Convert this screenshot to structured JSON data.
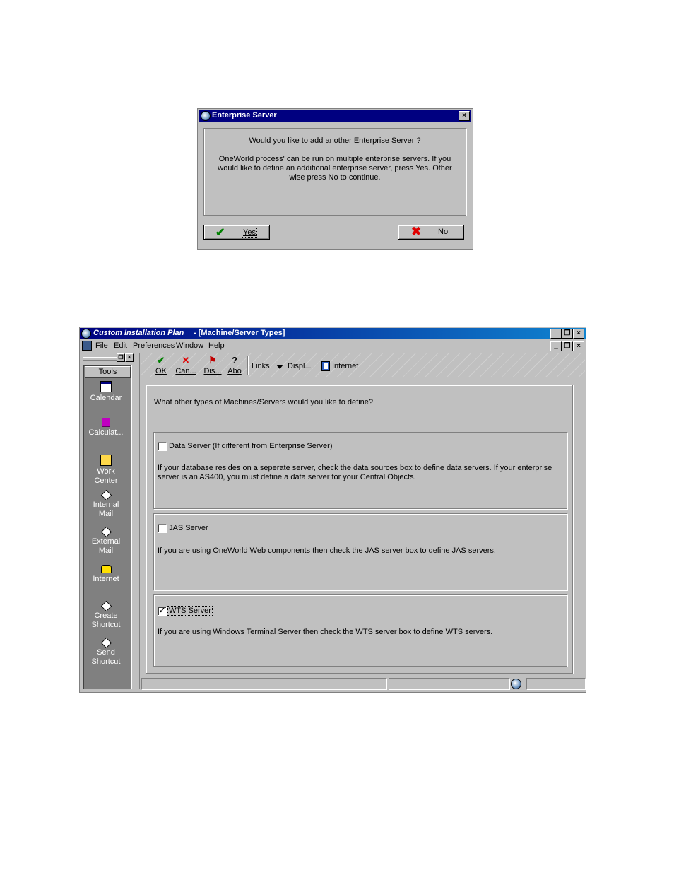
{
  "dialog": {
    "title": "Enterprise Server",
    "question": "Would you like to add another Enterprise Server ?",
    "body_line1": "OneWorld process' can be run on multiple enterprise servers.  If you",
    "body_line2": "would like to define an additional enterprise server, press Yes.  Other",
    "body_line3": "wise press No to continue.",
    "yes_label": "Yes",
    "no_label": "No",
    "close_label": "×"
  },
  "app": {
    "title_italic": "Custom Installation Plan",
    "title_rest": " - [Machine/Server Types]",
    "menu": [
      "File",
      "Edit",
      "Preferences",
      "Window",
      "Help"
    ],
    "toolbar": {
      "ok": "OK",
      "cancel": "Can...",
      "display": "Dis...",
      "about": "Abo",
      "links": "Links",
      "displ": "Displ...",
      "internet": "Internet"
    },
    "tools_header": "Tools",
    "tools": [
      {
        "line1": "Calendar",
        "line2": "",
        "icon": "calendar-icon"
      },
      {
        "line1": "Calculat...",
        "line2": "",
        "icon": "calculator-icon"
      },
      {
        "line1": "Work",
        "line2": "Center",
        "icon": "work-center-icon"
      },
      {
        "line1": "Internal",
        "line2": "Mail",
        "icon": "mail-icon"
      },
      {
        "line1": "External",
        "line2": "Mail",
        "icon": "mail-icon"
      },
      {
        "line1": "Internet",
        "line2": "",
        "icon": "phone-icon"
      },
      {
        "line1": "Create",
        "line2": "Shortcut",
        "icon": "shortcut-icon"
      },
      {
        "line1": "Send",
        "line2": "Shortcut",
        "icon": "shortcut-icon"
      }
    ],
    "form": {
      "question": "What other types of Machines/Servers would you like to define?",
      "sections": [
        {
          "label": "Data Server (If different from Enterprise Server)",
          "checked": false,
          "desc1": "If your database resides on a seperate server, check the data sources box to define data servers.  If your enterprise",
          "desc2": "server is an AS400, you must define a data server for your Central Objects."
        },
        {
          "label": "JAS Server",
          "checked": false,
          "desc1": "If you are using OneWorld Web components then check the JAS server box to define JAS servers.",
          "desc2": ""
        },
        {
          "label": "WTS Server",
          "checked": true,
          "desc1": "If you are using Windows Terminal Server then check the WTS server box to define WTS servers.",
          "desc2": ""
        }
      ]
    },
    "colors": {
      "title_start": "#000080",
      "title_end": "#1084d0",
      "face": "#c0c0c0",
      "tools_panel": "#808080"
    }
  }
}
